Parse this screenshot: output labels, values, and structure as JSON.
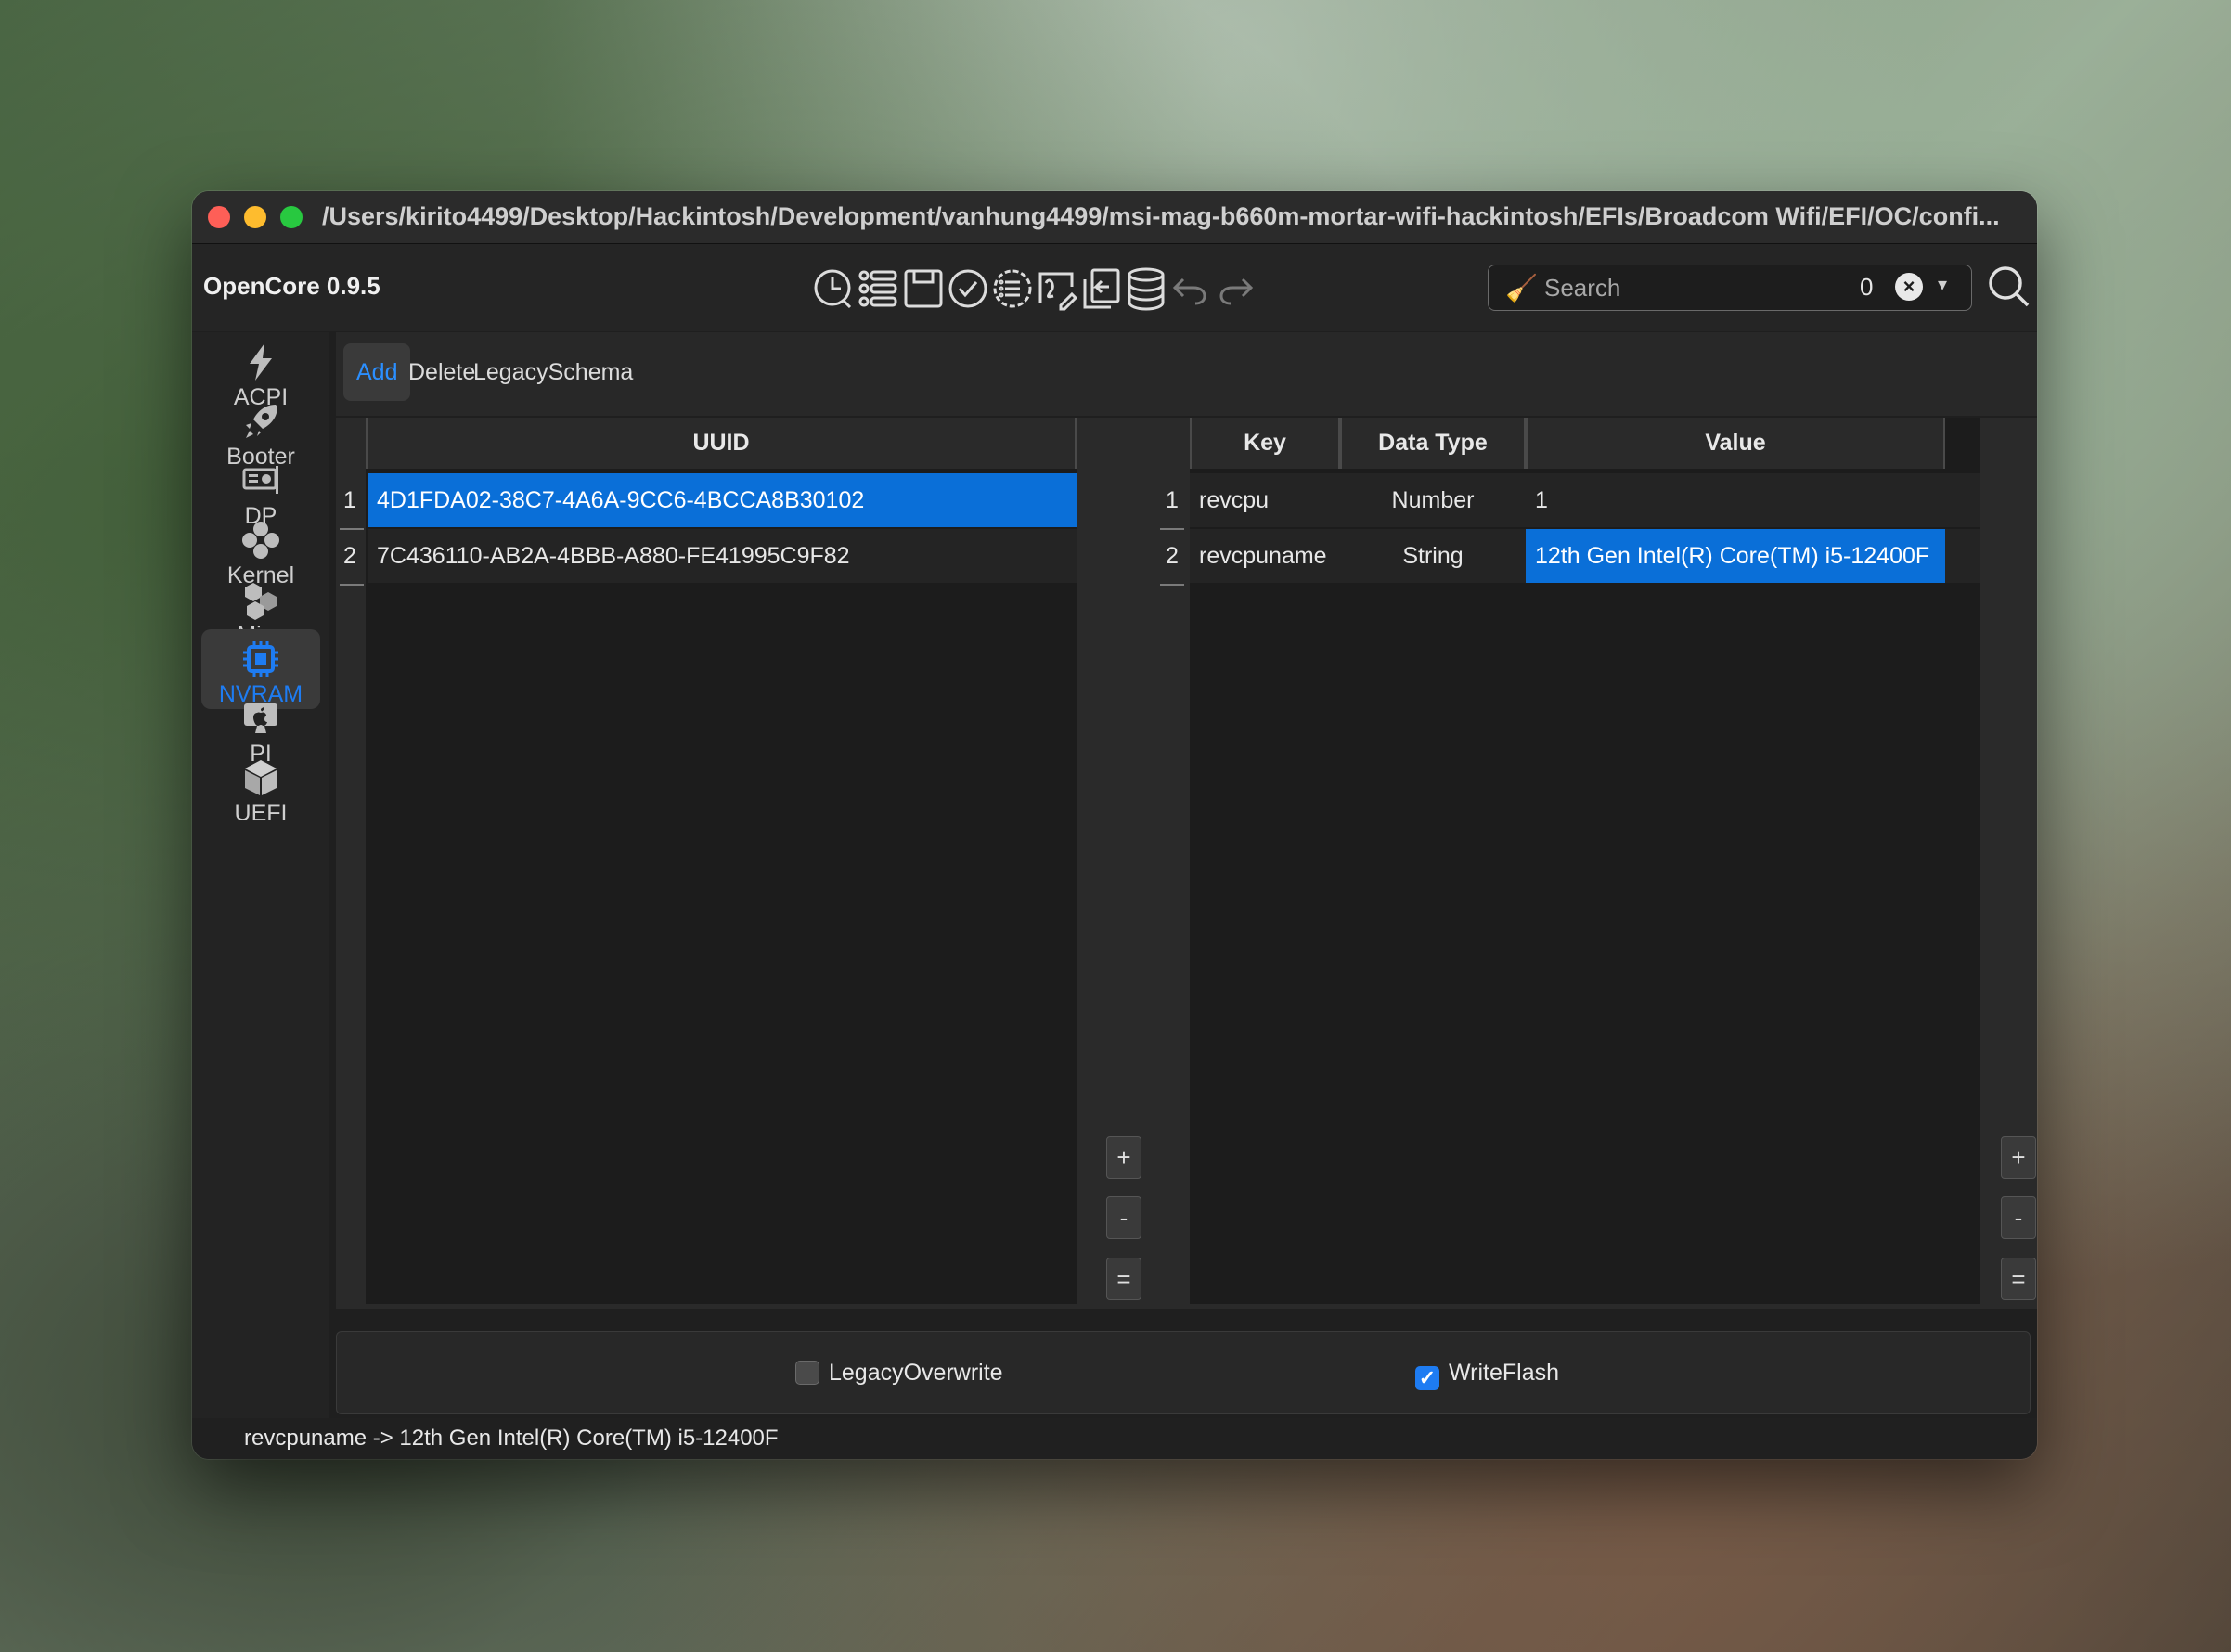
{
  "window": {
    "path_title": "/Users/kirito4499/Desktop/Hackintosh/Development/vanhung4499/msi-mag-b660m-mortar-wifi-hackintosh/EFIs/Broadcom Wifi/EFI/OC/confi...",
    "app_version": "OpenCore 0.9.5"
  },
  "toolbar": {
    "icons": [
      "clock-icon",
      "list-icon",
      "save-icon",
      "check-circle-icon",
      "list-circle-icon",
      "signature-icon",
      "import-icon",
      "database-icon",
      "undo-icon",
      "redo-icon"
    ],
    "search": {
      "placeholder": "Search",
      "count": "0",
      "clear_glyph": "×",
      "caret_glyph": "▾"
    }
  },
  "sidebar": {
    "items": [
      {
        "label": "ACPI",
        "icon": "bolt-icon"
      },
      {
        "label": "Booter",
        "icon": "rocket-icon"
      },
      {
        "label": "DP",
        "icon": "gpu-icon"
      },
      {
        "label": "Kernel",
        "icon": "kernel-icon"
      },
      {
        "label": "Misc",
        "icon": "misc-icon"
      },
      {
        "label": "NVRAM",
        "icon": "chip-icon",
        "active": true
      },
      {
        "label": "PI",
        "icon": "apple-icon"
      },
      {
        "label": "UEFI",
        "icon": "cube-icon"
      }
    ]
  },
  "tabs": [
    {
      "label": "Add",
      "active": true
    },
    {
      "label": "Delete"
    },
    {
      "label": "LegacySchema"
    }
  ],
  "uuid_table": {
    "header": "UUID",
    "rows": [
      {
        "num": "1",
        "uuid": "4D1FDA02-38C7-4A6A-9CC6-4BCCA8B30102",
        "selected": true
      },
      {
        "num": "2",
        "uuid": "7C436110-AB2A-4BBB-A880-FE41995C9F82"
      }
    ]
  },
  "kv_table": {
    "headers": {
      "key": "Key",
      "type": "Data Type",
      "value": "Value"
    },
    "rows": [
      {
        "num": "1",
        "key": "revcpu",
        "type": "Number",
        "value": "1"
      },
      {
        "num": "2",
        "key": "revcpuname",
        "type": "String",
        "value": "12th Gen Intel(R) Core(TM) i5-12400F",
        "selected": true
      }
    ]
  },
  "side_buttons": {
    "add": "+",
    "remove": "-",
    "copy": "="
  },
  "options": {
    "legacy_overwrite": {
      "label": "LegacyOverwrite",
      "checked": false
    },
    "write_flash": {
      "label": "WriteFlash",
      "checked": true
    }
  },
  "status": "revcpuname -> 12th Gen Intel(R) Core(TM) i5-12400F",
  "colors": {
    "accent": "#1e7cf2",
    "selection": "#0a6fd8",
    "window_bg": "#1f1f1f"
  }
}
